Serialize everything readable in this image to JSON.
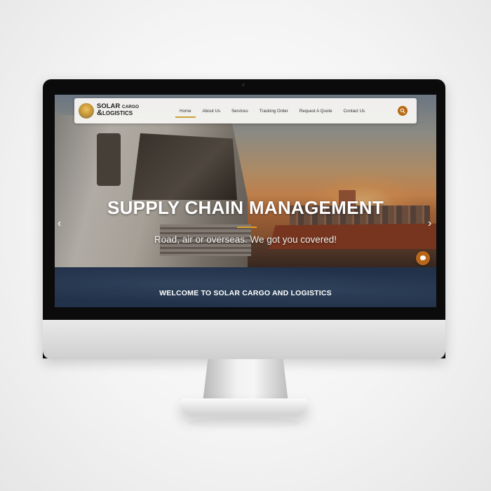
{
  "logo": {
    "word_solar": "SOLAR",
    "word_cargo": "CARGO",
    "ampersand": "&",
    "word_logistics": "LOGISTICS"
  },
  "nav": {
    "items": [
      {
        "label": "Home",
        "active": true
      },
      {
        "label": "About Us",
        "active": false
      },
      {
        "label": "Services",
        "active": false
      },
      {
        "label": "Tracking Order",
        "active": false
      },
      {
        "label": "Request A Quote",
        "active": false
      },
      {
        "label": "Contact Us",
        "active": false
      }
    ],
    "search_icon": "search-icon"
  },
  "hero": {
    "title": "SUPPLY CHAIN MANAGEMENT",
    "subtitle": "Road, air or overseas. We got you covered!",
    "prev_arrow": "‹",
    "next_arrow": "›"
  },
  "welcome": {
    "title": "WELCOME TO SOLAR CARGO AND LOGISTICS"
  },
  "colors": {
    "accent": "#b86a14",
    "divider": "#d9a12b",
    "welcome_bg": "#22324a"
  }
}
